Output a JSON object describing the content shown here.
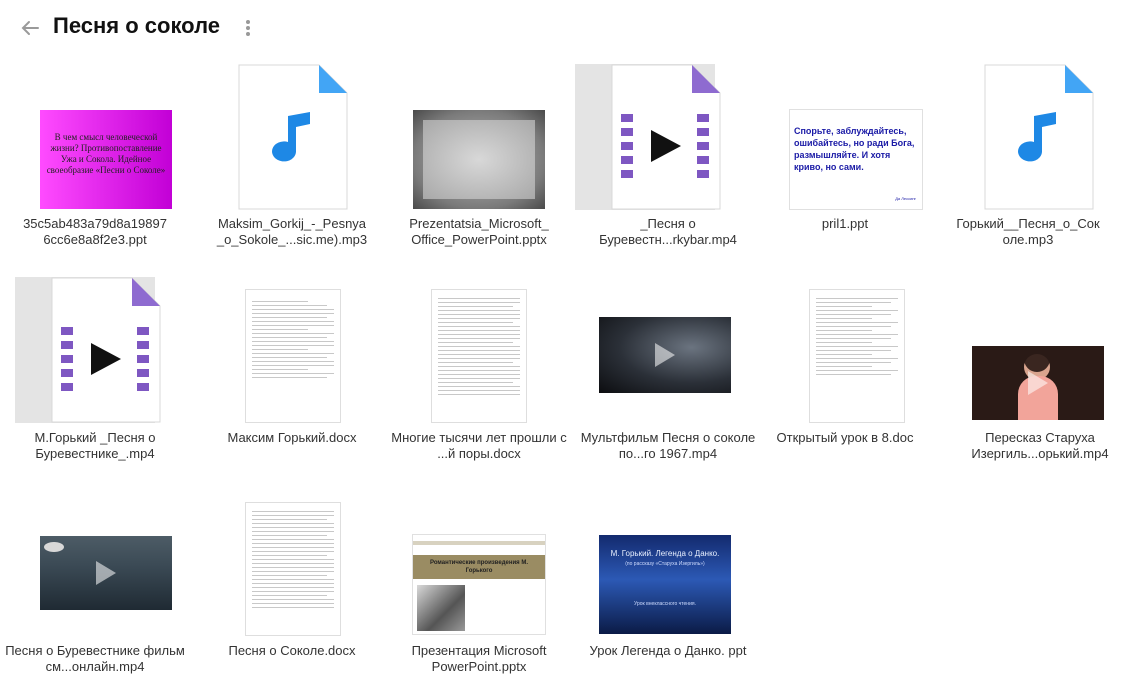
{
  "header": {
    "title": "Песня о соколе"
  },
  "files": [
    {
      "name": "35c5ab483a79d8a19897 6cc6e8a8f2e3.ppt",
      "type": "ppt"
    },
    {
      "name": "Maksim_Gorkij_-_Pesnya _o_Sokole_...sic.me).mp3",
      "type": "mp3"
    },
    {
      "name": "Prezentatsia_Microsoft_ Office_PowerPoint.pptx",
      "type": "pptx"
    },
    {
      "name": "_Песня о Буревестн...rkybar.mp4",
      "type": "mp4"
    },
    {
      "name": "pril1.ppt",
      "type": "ppt"
    },
    {
      "name": "Горький__Песня_о_Сок оле.mp3",
      "type": "mp3"
    },
    {
      "name": "М.Горький _Песня о Буревестнике_.mp4",
      "type": "mp4"
    },
    {
      "name": "Максим Горький.docx",
      "type": "docx"
    },
    {
      "name": "Многие тысячи лет прошли с ...й поры.docx",
      "type": "docx"
    },
    {
      "name": "Мультфильм Песня о соколе по...го 1967.mp4",
      "type": "mp4"
    },
    {
      "name": "Открытый урок в 8.doc",
      "type": "doc"
    },
    {
      "name": "Пересказ Старуха Изергиль...орький.mp4",
      "type": "mp4"
    },
    {
      "name": "Песня о Буревестнике фильм см...онлайн.mp4",
      "type": "mp4"
    },
    {
      "name": "Песня о Соколе.docx",
      "type": "docx"
    },
    {
      "name": "Презентация Microsoft PowerPoint.pptx",
      "type": "pptx"
    },
    {
      "name": "Урок Легенда о Данко. ppt",
      "type": "ppt"
    }
  ],
  "previews": {
    "slide1": "В чем смысл человеческой жизни? Противопоставление Ужа и Сокола. Идейное своеобразие «Песни о Соколе»",
    "pril1": "Спорьте, заблуждайтесь, ошибайтесь, но ради Бога, размышляйте. И хотя криво, но сами.",
    "pril1_author": "Да Лессинг",
    "romantic": "Романтические произведения М. Горького",
    "danko_title": "М. Горький. Легенда о Данко.",
    "danko_sub": "(по рассказу «Старуха Изергиль»)",
    "danko_note": "Урок внеклассного чтения."
  },
  "colors": {
    "audio": "#1e88e5",
    "video": "#7e57c2",
    "corner_audio": "#42a5f5",
    "corner_video": "#8e6bd0"
  }
}
